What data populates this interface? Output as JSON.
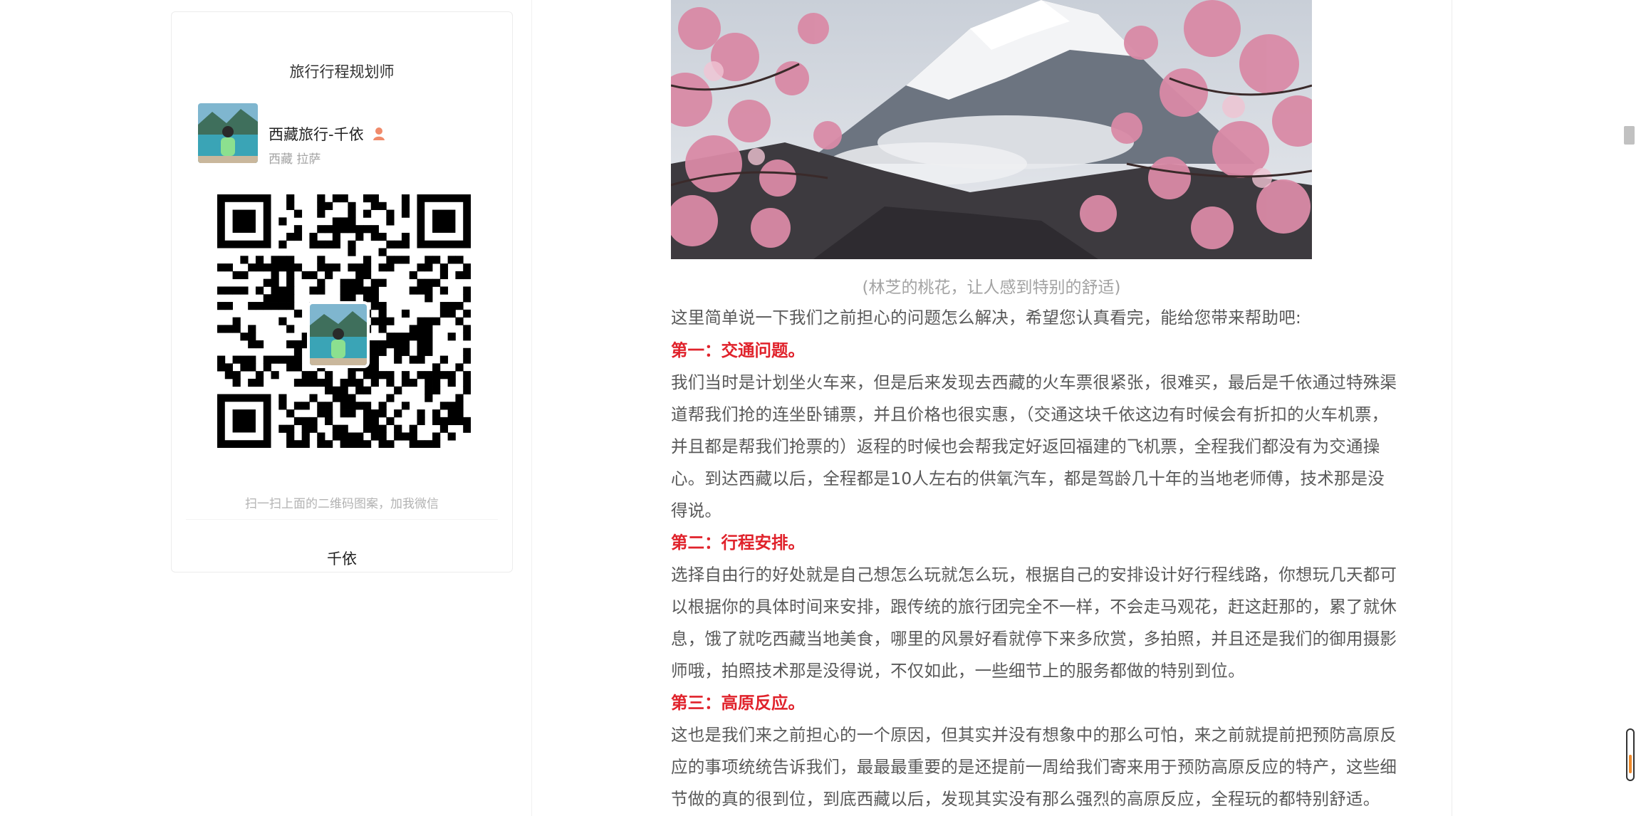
{
  "sidebar": {
    "card_title": "旅行行程规划师",
    "profile_name": "西藏旅行-千依",
    "profile_location": "西藏 拉萨",
    "scan_hint": "扫一扫上面的二维码图案，加我微信",
    "footer_name": "千依"
  },
  "article": {
    "caption": "(林芝的桃花，让人感到特别的舒适)",
    "intro": "这里简单说一下我们之前担心的问题怎么解决，希望您认真看完，能给您带来帮助吧:",
    "sections": [
      {
        "heading": "第一：交通问题。",
        "lines": [
          "我们当时是计划坐火车来，但是后来发现去西藏的火车票很紧张，很难买，最后是千依通过特殊渠",
          "道帮我们抢的连坐卧铺票，并且价格也很实惠，（交通这块千依这边有时候会有折扣的火车机票，",
          "并且都是帮我们抢票的）返程的时候也会帮我定好返回福建的飞机票，全程我们都没有为交通操",
          "心。到达西藏以后，全程都是10人左右的供氧汽车，都是驾龄几十年的当地老师傅，技术那是没",
          "得说。"
        ]
      },
      {
        "heading": "第二：行程安排。",
        "lines": [
          "选择自由行的好处就是自己想怎么玩就怎么玩，根据自己的安排设计好行程线路，你想玩几天都可",
          "以根据你的具体时间来安排，跟传统的旅行团完全不一样，不会走马观花，赶这赶那的，累了就休",
          "息，饿了就吃西藏当地美食，哪里的风景好看就停下来多欣赏，多拍照，并且还是我们的御用摄影",
          "师哦，拍照技术那是没得说，不仅如此，一些细节上的服务都做的特别到位。"
        ]
      },
      {
        "heading": "第三：高原反应。",
        "lines": [
          "这也是我们来之前担心的一个原因，但其实并没有想象中的那么可怕，来之前就提前把预防高原反",
          "应的事项统统告诉我们，最最最重要的是还提前一周给我们寄来用于预防高原反应的特产，这些细",
          "节做的真的很到位，到底西藏以后，发现其实没有那么强烈的高原反应，全程玩的都特别舒适。"
        ]
      }
    ]
  },
  "icons": {
    "profile_badge": "person-emoji-icon",
    "qr": "wechat-qr-code"
  },
  "colors": {
    "heading_red": "#e0222b",
    "body_text": "#595959",
    "caption_gray": "#a3a3a3"
  }
}
